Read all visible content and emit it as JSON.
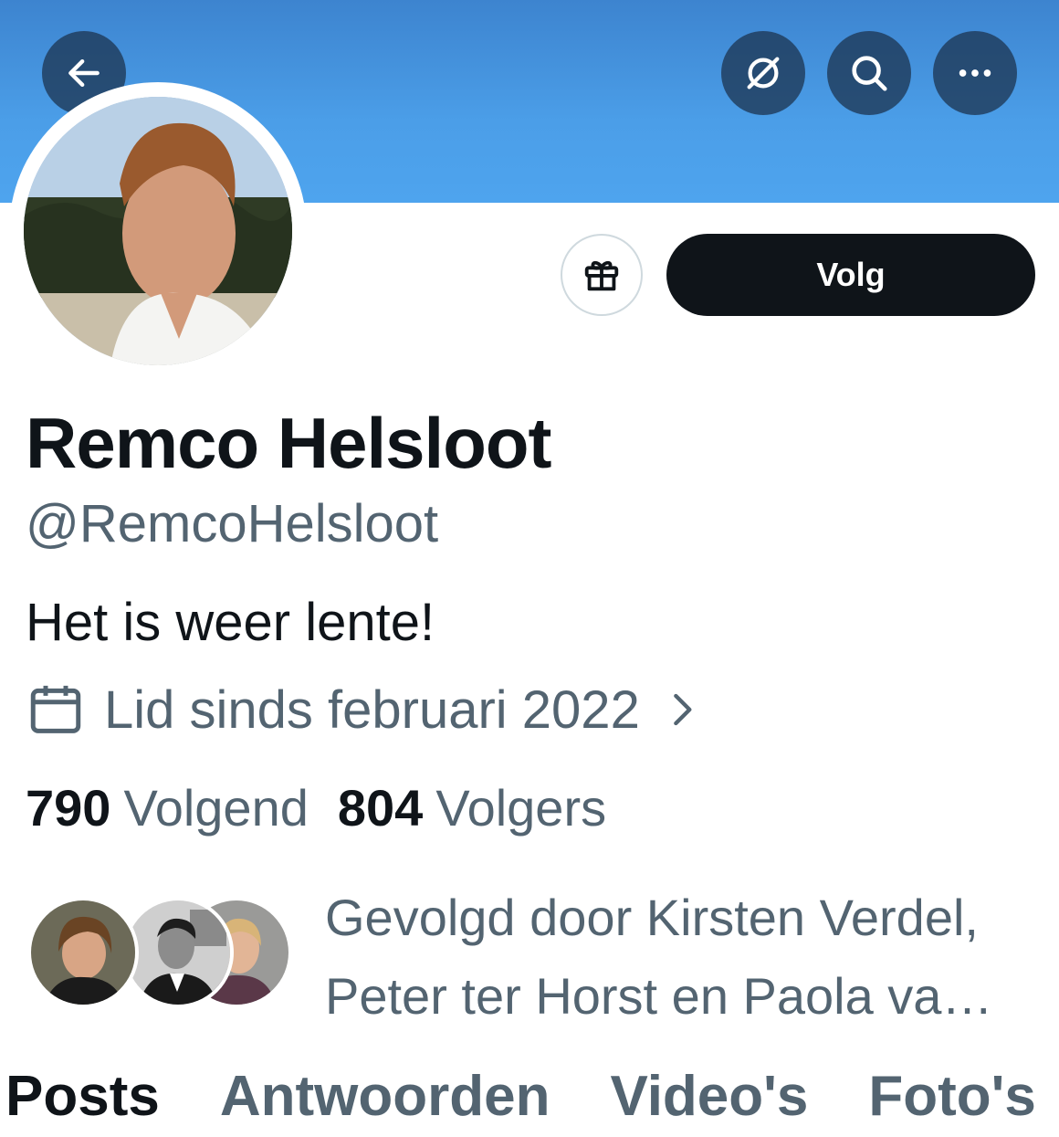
{
  "header": {
    "back_icon": "arrow-left-icon",
    "grok_icon": "grok-icon",
    "search_icon": "search-icon",
    "more_icon": "more-horizontal-icon"
  },
  "profile": {
    "name": "Remco Helsloot",
    "handle": "@RemcoHelsloot",
    "bio": "Het is weer lente!",
    "joined": "Lid sinds februari 2022",
    "following_count": "790",
    "following_label": "Volgend",
    "followers_count": "804",
    "followers_label": "Volgers",
    "followed_by": "Gevolgd door Kirsten Verdel, Peter ter Horst en Paola va…"
  },
  "actions": {
    "follow_label": "Volg",
    "gift_icon": "gift-icon"
  },
  "tabs": [
    "Posts",
    "Antwoorden",
    "Video's",
    "Foto's"
  ],
  "colors": {
    "banner": "#4b9ee8",
    "text_primary": "#0f1419",
    "text_secondary": "#536471",
    "button_dark": "#0f1419"
  }
}
